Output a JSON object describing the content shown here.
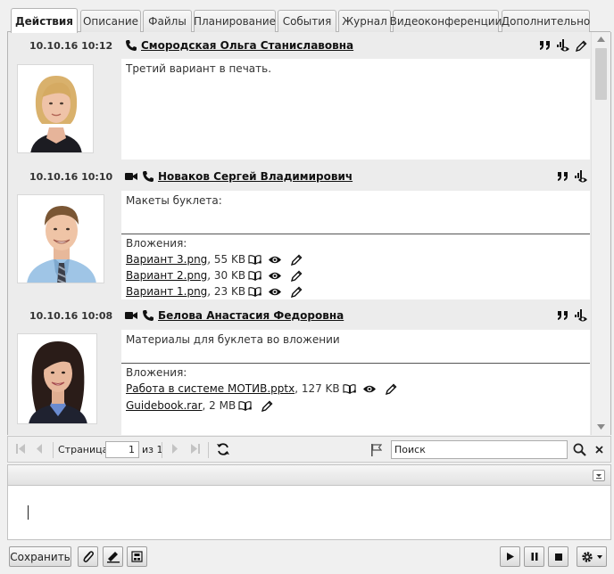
{
  "tabs": [
    {
      "label": "Действия",
      "active": true
    },
    {
      "label": "Описание"
    },
    {
      "label": "Файлы"
    },
    {
      "label": "Планирование"
    },
    {
      "label": "События"
    },
    {
      "label": "Журнал"
    },
    {
      "label": "Видеоконференции"
    },
    {
      "label": "Дополнительно"
    }
  ],
  "entries": [
    {
      "date": "10.10.16 10:12",
      "author": "Смородская Ольга Станиславовна",
      "message": "Третий вариант в печать."
    },
    {
      "date": "10.10.16 10:10",
      "author": "Новаков Сергей Владимирович",
      "message": "Макеты буклета:",
      "attachments_label": "Вложения:",
      "attachments": [
        {
          "name": "Вариант 3.png",
          "size": ", 55 KB"
        },
        {
          "name": "Вариант 2.png",
          "size": ", 30 KB"
        },
        {
          "name": "Вариант 1.png",
          "size": ", 23 KB"
        }
      ]
    },
    {
      "date": "10.10.16 10:08",
      "author": "Белова Анастасия Федоровна",
      "message": "Материалы для буклета во вложении",
      "attachments_label": "Вложения:",
      "attachments": [
        {
          "name": "Работа в системе МОТИВ.pptx",
          "size": ", 127 KB"
        },
        {
          "name": "Guidebook.rar",
          "size": ", 2 MB"
        }
      ]
    }
  ],
  "pager": {
    "page_label": "Страница",
    "page_value": "1",
    "of_label": "из 1",
    "search_placeholder": "Поиск"
  },
  "toolbar": {
    "save_label": "Сохранить"
  },
  "icons": {
    "phone": "phone-icon",
    "video": "video-camera-icon",
    "quote": "quote-icon",
    "viewers": "signal-eye-icon",
    "edit": "pencil-icon",
    "open_book": "open-book-icon",
    "eye": "eye-icon",
    "refresh": "refresh-icon",
    "flag": "flag-icon",
    "search": "magnifier-icon",
    "clear": "close-icon",
    "attach": "paperclip-icon",
    "signature": "signature-icon",
    "template": "template-icon",
    "play": "play-icon",
    "pause": "pause-icon",
    "stop": "stop-icon",
    "settings": "gear-icon"
  }
}
